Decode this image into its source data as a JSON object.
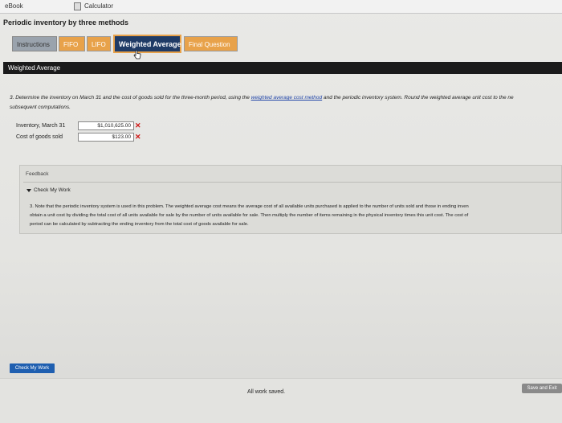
{
  "topbar": {
    "ebook": "eBook",
    "calculator": "Calculator"
  },
  "page_title": "Periodic inventory by three methods",
  "tabs": [
    {
      "label": "Instructions"
    },
    {
      "label": "FIFO"
    },
    {
      "label": "LIFO"
    },
    {
      "label": "Weighted Average"
    },
    {
      "label": "Final Question"
    }
  ],
  "section": {
    "title": "Weighted Average"
  },
  "question": {
    "text_a": "3. Determine the inventory on March 31 and the cost of goods sold for the three-month period, using the ",
    "link": "weighted average cost method",
    "text_b": " and the periodic inventory system. Round the weighted average unit cost to the ne",
    "text_c": "subsequent computations."
  },
  "answers": {
    "inventory_label": "Inventory, March 31",
    "inventory_value": "$1,010,625.00",
    "cogs_label": "Cost of goods sold",
    "cogs_value": "$123.00"
  },
  "feedback": {
    "label": "Feedback",
    "toggle": "Check My Work",
    "line1": "3. Note that the periodic inventory system is used in this problem. The weighted average cost means the average cost of all available units purchased is applied to the number of units sold and those in ending inven",
    "line2": "obtain a unit cost by dividing the total cost of all units available for sale by the number of units available for sale. Then multiply the number of items remaining in the physical inventory times this unit cost. The cost of",
    "line3": "period can be calculated by subtracting the ending inventory from the total cost of goods available for sale."
  },
  "buttons": {
    "check_my_work": "Check My Work",
    "save_and_exit": "Save and Exit"
  },
  "status": {
    "saved": "All work saved."
  },
  "colors": {
    "tab_orange": "#e8a24a",
    "tab_active": "#1f3b66",
    "error_red": "#d01818",
    "link_blue": "#2246a8"
  }
}
